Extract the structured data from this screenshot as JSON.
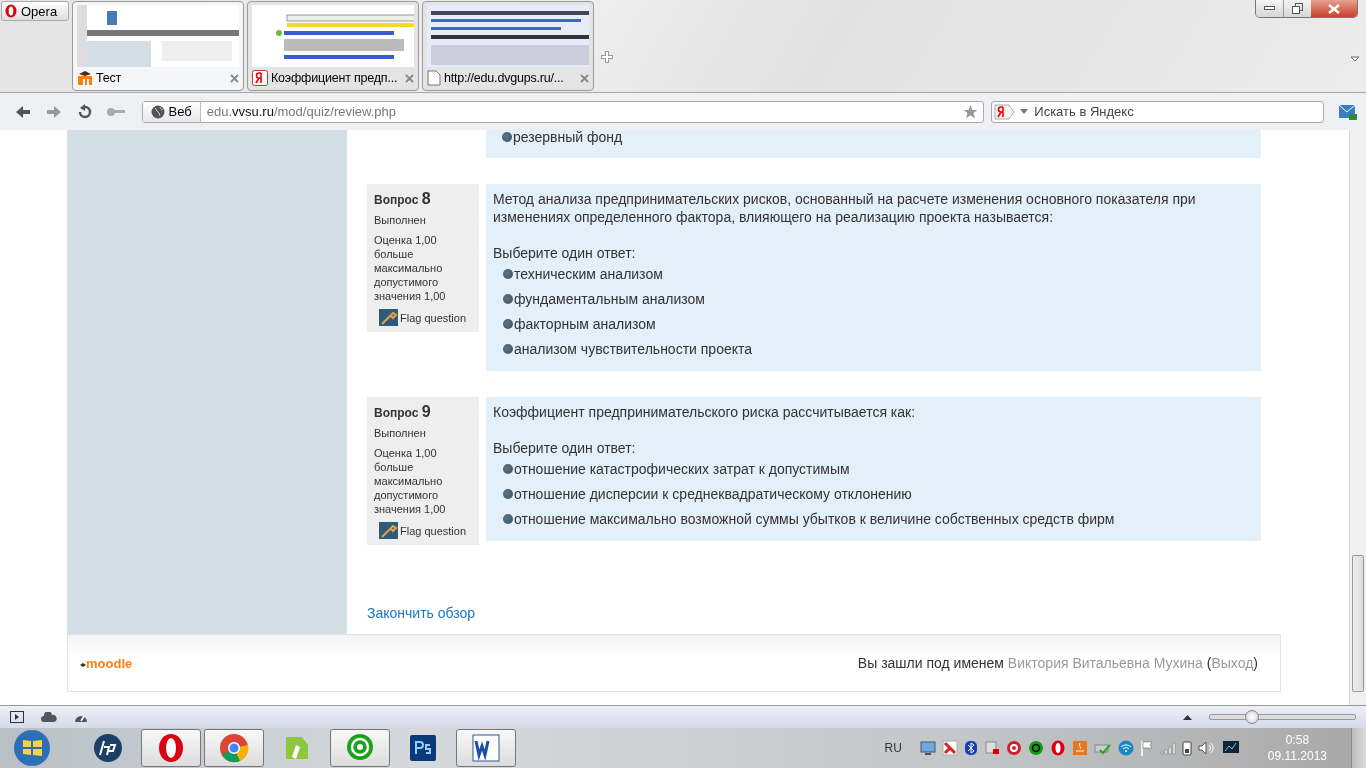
{
  "browser": {
    "menu_button": "Opera",
    "tabs": [
      {
        "title": "Тест",
        "selected": true,
        "kind": "moodle"
      },
      {
        "title": "Коэффициент предп...",
        "selected": false,
        "kind": "yandex"
      },
      {
        "title": "http://edu.dvgups.ru/...",
        "selected": false,
        "kind": "page"
      }
    ],
    "address": {
      "badge": "Веб",
      "url": "edu.**vvsu.ru**/mod/quiz/review.php"
    },
    "search": {
      "placeholder": "Искать в Яндекс"
    }
  },
  "questions": [
    {
      "options": [
        "резервный фонд"
      ]
    },
    {
      "label": "Вопрос",
      "number": "8",
      "state": "Выполнен",
      "grade": "Оценка 1,00 больше максимально допустимого значения 1,00",
      "flag": "Flag question",
      "text": "Метод анализа предпринимательских рисков, основанный на расчете изменения основного показателя при изменениях определенного фактора, влияющего на реализацию проекта называется:",
      "prompt": "Выберите один ответ:",
      "options": [
        "техническим анализом",
        "фундаментальным анализом",
        "факторным анализом",
        "анализом чувствительности проекта"
      ]
    },
    {
      "label": "Вопрос",
      "number": "9",
      "state": "Выполнен",
      "grade": "Оценка 1,00 больше максимально допустимого значения 1,00",
      "flag": "Flag question",
      "text": "Коэффициент предпринимательского риска рассчитывается как:",
      "prompt": "Выберите один ответ:",
      "options": [
        "отношение катастрофических затрат к допустимым",
        "отношение дисперсии к среднеквадратическому отклонению",
        "отношение максимально возможной суммы убытков к величине собственных средств фирм"
      ]
    }
  ],
  "finish_link": "Закончить обзор",
  "footer": {
    "logo": "moodle",
    "login_text": "Вы зашли под именем",
    "user": "Виктория Витальевна Мухина",
    "paren_open": "(",
    "logout": "Выход",
    "paren_close": ")"
  },
  "status_bar": {
    "zoom": {
      "level": 0.28
    }
  },
  "taskbar": {
    "apps": [
      {
        "kind": "hp",
        "running": false
      },
      {
        "kind": "opera",
        "running": true
      },
      {
        "kind": "chrome",
        "running": true
      },
      {
        "kind": "corel",
        "running": false
      },
      {
        "kind": "mail",
        "running": true
      },
      {
        "kind": "photoshop",
        "running": false
      },
      {
        "kind": "word",
        "running": true
      }
    ],
    "language": "RU",
    "time": "0:58",
    "date": "09.11.2013"
  }
}
